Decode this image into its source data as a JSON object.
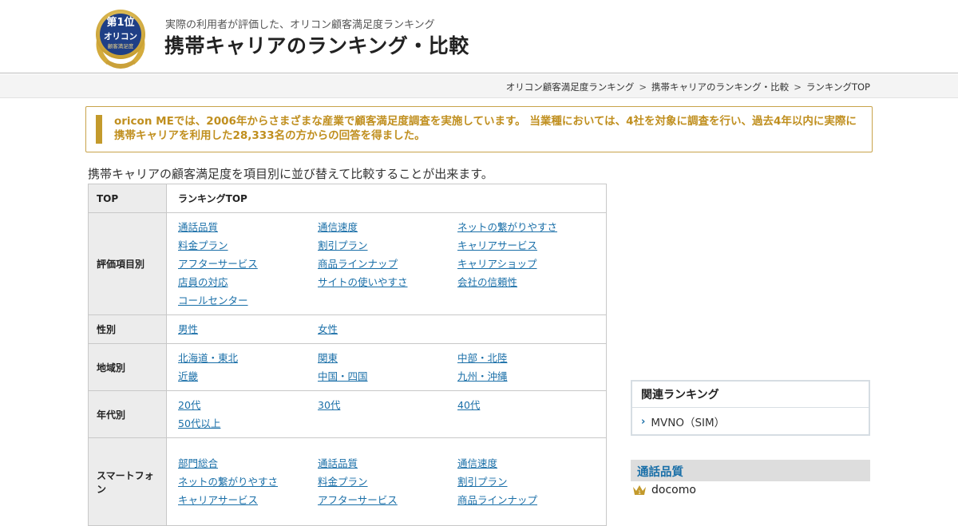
{
  "header": {
    "logo": {
      "rank_text": "第1位",
      "brand_text": "オリコン",
      "award_text": "顧客満足度"
    },
    "subtitle": "実際の利用者が評価した、オリコン顧客満足度ランキング",
    "title": "携帯キャリアのランキング・比較"
  },
  "breadcrumb": [
    "オリコン顧客満足度ランキング",
    "携帯キャリアのランキング・比較",
    "ランキングTOP"
  ],
  "breadcrumb_sep": ">",
  "notice": "oricon MEでは、2006年からさまざまな産業で顧客満足度調査を実施しています。 当業種においては、4社を対象に調査を行い、過去4年以内に実際に携帯キャリアを利用した28,333名の方からの回答を得ました。",
  "intro": "携帯キャリアの顧客満足度を項目別に並び替えて比較することが出来ます。",
  "table": {
    "rows": [
      {
        "label": "TOP",
        "plain": "ランキングTOP"
      },
      {
        "label": "評価項目別",
        "links": [
          "通話品質",
          "通信速度",
          "ネットの繋がりやすさ",
          "料金プラン",
          "割引プラン",
          "キャリアサービス",
          "アフターサービス",
          "商品ラインナップ",
          "キャリアショップ",
          "店員の対応",
          "サイトの使いやすさ",
          "会社の信頼性",
          "コールセンター"
        ]
      },
      {
        "label": "性別",
        "links": [
          "男性",
          "女性"
        ]
      },
      {
        "label": "地域別",
        "links": [
          "北海道・東北",
          "関東",
          "中部・北陸",
          "近畿",
          "中国・四国",
          "九州・沖縄"
        ]
      },
      {
        "label": "年代別",
        "links": [
          "20代",
          "30代",
          "40代",
          "50代以上"
        ]
      },
      {
        "label": "スマートフォン",
        "links": [
          "部門総合",
          "通話品質",
          "通信速度",
          "ネットの繋がりやすさ",
          "料金プラン",
          "割引プラン",
          "キャリアサービス",
          "アフターサービス",
          "商品ラインナップ"
        ]
      }
    ]
  },
  "related": {
    "title": "関連ランキング",
    "items": [
      "MVNO（SIM）"
    ]
  },
  "category": {
    "title": "通話品質",
    "first": "docomo"
  },
  "colors": {
    "link": "#1a6fa8",
    "notice_text": "#c08f1f",
    "notice_border": "#c8a34a",
    "gold": "#c39a2c",
    "logo_navy": "#1f3f86"
  }
}
